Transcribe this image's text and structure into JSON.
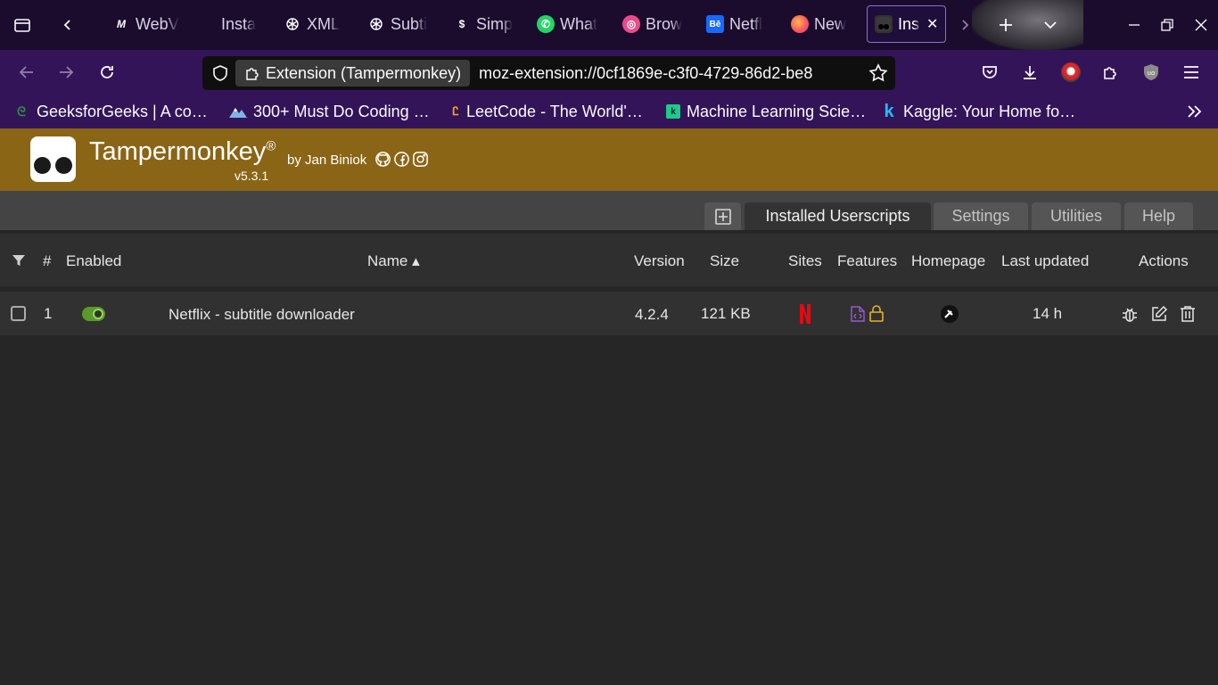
{
  "browser": {
    "tabs": [
      {
        "label": "WebV",
        "icon": "letter-m-icon"
      },
      {
        "label": "Insta",
        "icon": "blank-icon"
      },
      {
        "label": "XML",
        "icon": "openai-icon"
      },
      {
        "label": "Subti",
        "icon": "openai-icon"
      },
      {
        "label": "Simp",
        "icon": "simplify-icon"
      },
      {
        "label": "What",
        "icon": "whatsapp-icon"
      },
      {
        "label": "Brow",
        "icon": "dribbble-icon"
      },
      {
        "label": "Netfl",
        "icon": "behance-icon"
      },
      {
        "label": "New",
        "icon": "firefox-icon"
      },
      {
        "label": "Ins",
        "icon": "tampermonkey-icon",
        "active": true
      }
    ],
    "identity_label": "Extension (Tampermonkey)",
    "url": "moz-extension://0cf1869e-c3f0-4729-86d2-be8",
    "bookmarks": [
      {
        "label": "GeeksforGeeks | A co…",
        "icon": "gfg-icon",
        "color": "#2f8d46"
      },
      {
        "label": "300+ Must Do Coding …",
        "icon": "mountain-icon",
        "color": "#7fb5e6"
      },
      {
        "label": "LeetCode - The World'…",
        "icon": "leetcode-icon",
        "color": "#ffa116"
      },
      {
        "label": "Machine Learning Scie…",
        "icon": "ml-icon",
        "color": "#1ec98a"
      },
      {
        "label": "Kaggle: Your Home fo…",
        "icon": "kaggle-icon",
        "color": "#20beff"
      }
    ]
  },
  "tampermonkey": {
    "title": "Tampermonkey",
    "registered": "®",
    "by": "by Jan Biniok",
    "version": "v5.3.1",
    "tabs": [
      {
        "label": "Installed Userscripts",
        "active": true
      },
      {
        "label": "Settings"
      },
      {
        "label": "Utilities"
      },
      {
        "label": "Help"
      }
    ],
    "table": {
      "columns": {
        "num": "#",
        "enabled": "Enabled",
        "name": "Name ▴",
        "version": "Version",
        "size": "Size",
        "sites": "Sites",
        "features": "Features",
        "homepage": "Homepage",
        "last_updated": "Last updated",
        "actions": "Actions"
      },
      "rows": [
        {
          "num": "1",
          "enabled": true,
          "name": "Netflix - subtitle downloader",
          "version": "4.2.4",
          "size": "121 KB",
          "site_icon": "netflix-icon",
          "last_updated": "14 h"
        }
      ]
    }
  },
  "colors": {
    "header_bg": "#8b6516",
    "browser_chrome": "#341458",
    "tabstrip": "#1b0c2e",
    "toggle_on": "#5a9a2a",
    "netflix_red": "#e50914",
    "feature_purple": "#9b59d0",
    "feature_yellow": "#e6b422"
  }
}
